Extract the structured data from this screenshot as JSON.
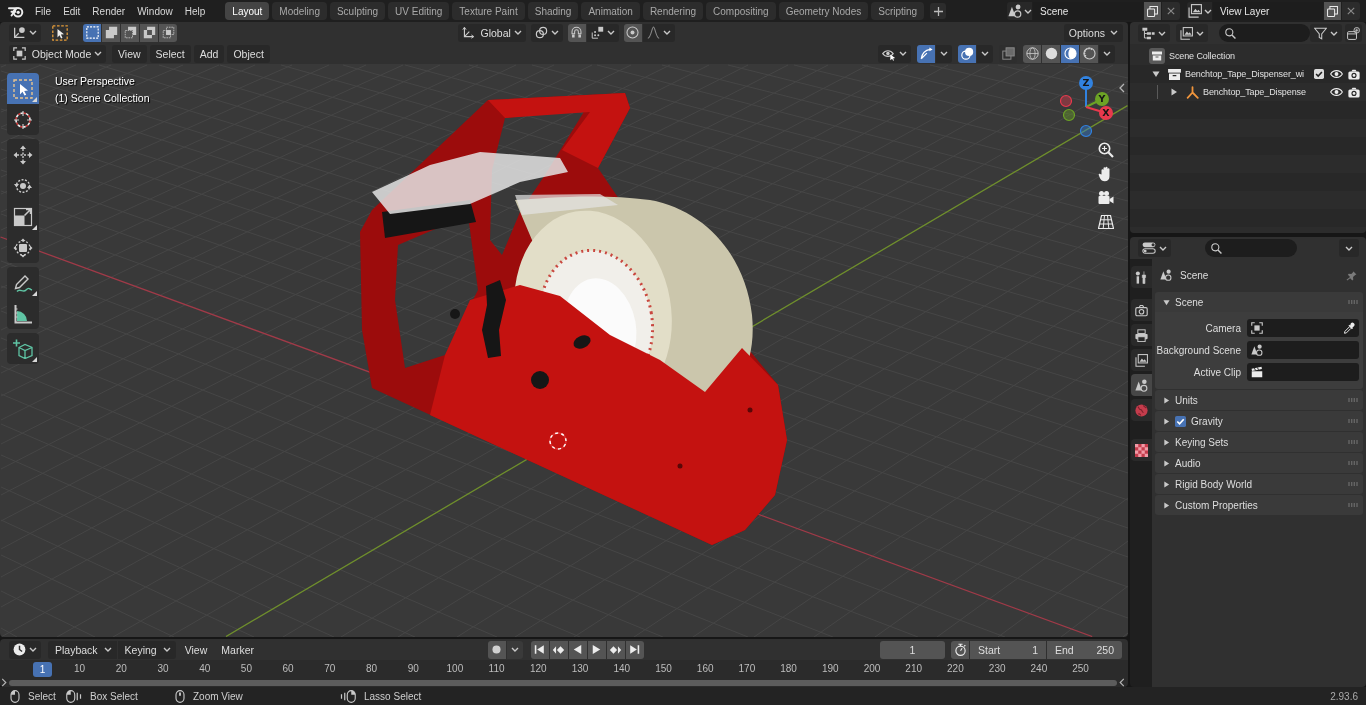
{
  "topbar": {
    "menus": [
      "File",
      "Edit",
      "Render",
      "Window",
      "Help"
    ],
    "workspaces": [
      {
        "label": "Layout",
        "selected": true
      },
      {
        "label": "Modeling",
        "selected": false
      },
      {
        "label": "Sculpting",
        "selected": false
      },
      {
        "label": "UV Editing",
        "selected": false
      },
      {
        "label": "Texture Paint",
        "selected": false
      },
      {
        "label": "Shading",
        "selected": false
      },
      {
        "label": "Animation",
        "selected": false
      },
      {
        "label": "Rendering",
        "selected": false
      },
      {
        "label": "Compositing",
        "selected": false
      },
      {
        "label": "Geometry Nodes",
        "selected": false
      },
      {
        "label": "Scripting",
        "selected": false
      }
    ],
    "scene": "Scene",
    "view_layer": "View Layer"
  },
  "viewport": {
    "tool_header": {
      "select_modes": [
        {
          "kind": "set",
          "selected": true
        },
        {
          "kind": "extend",
          "selected": false
        },
        {
          "kind": "subtract",
          "selected": false
        },
        {
          "kind": "difference",
          "selected": false
        },
        {
          "kind": "intersect",
          "selected": false
        }
      ],
      "orientation": "Global",
      "snap": {
        "on": false
      },
      "proportional": {
        "on": false
      },
      "options": "Options"
    },
    "header": {
      "mode": "Object Mode",
      "menus": [
        "View",
        "Select",
        "Add",
        "Object"
      ],
      "gizmos": {
        "on": true
      },
      "overlays": {
        "on": true
      },
      "xray": {
        "on": false
      },
      "shading": [
        {
          "kind": "wireframe",
          "selected": false
        },
        {
          "kind": "solid",
          "selected": false
        },
        {
          "kind": "material",
          "selected": true
        },
        {
          "kind": "rendered",
          "selected": false
        }
      ]
    },
    "view_name": "User Perspective",
    "collection_label": "(1) Scene Collection",
    "tool_groups": [
      [
        {
          "kind": "select_box",
          "selected": true
        },
        {
          "kind": "cursor",
          "selected": false
        }
      ],
      [
        {
          "kind": "move",
          "selected": false
        },
        {
          "kind": "rotate",
          "selected": false
        },
        {
          "kind": "scale",
          "selected": false
        },
        {
          "kind": "transform",
          "selected": false
        }
      ],
      [
        {
          "kind": "annotate",
          "selected": false
        },
        {
          "kind": "measure",
          "selected": false
        }
      ],
      [
        {
          "kind": "add_cube",
          "selected": false
        }
      ]
    ],
    "navigation_gizmo": {
      "axes": [
        {
          "kind": "z",
          "label": "Z",
          "color": "#3182e0"
        },
        {
          "kind": "y",
          "label": "Y",
          "color": "#6ca325"
        },
        {
          "kind": "x",
          "label": "X",
          "color": "#e8394d"
        }
      ]
    }
  },
  "timeline": {
    "dropdowns": [
      "Playback",
      "Keying"
    ],
    "menus": [
      "View",
      "Marker"
    ],
    "auto_keying": {
      "on": false
    },
    "current_frame": "1",
    "start": {
      "label": "Start",
      "value": "1"
    },
    "end": {
      "label": "End",
      "value": "250"
    },
    "playhead": "1",
    "frame_labels": [
      "10",
      "20",
      "30",
      "40",
      "50",
      "60",
      "70",
      "80",
      "90",
      "100",
      "110",
      "120",
      "130",
      "140",
      "150",
      "160",
      "170",
      "180",
      "190",
      "200",
      "210",
      "220",
      "230",
      "240",
      "250"
    ]
  },
  "outliner": {
    "tree": [
      {
        "label": "Scene Collection",
        "kind": "scene_collection",
        "children": [
          {
            "label": "Benchtop_Tape_Dispenser_wi",
            "kind": "collection",
            "expanded": true,
            "checked": true,
            "visible": true,
            "renderable": true,
            "children": [
              {
                "label": "Benchtop_Tape_Dispense",
                "kind": "object",
                "expanded": false,
                "visible": true,
                "renderable": true
              }
            ]
          }
        ]
      }
    ]
  },
  "properties": {
    "tabs": [
      {
        "kind": "tool",
        "selected": false
      },
      {
        "kind": "render",
        "selected": false
      },
      {
        "kind": "output",
        "selected": false
      },
      {
        "kind": "view_layer",
        "selected": false
      },
      {
        "kind": "scene",
        "selected": true
      },
      {
        "kind": "world",
        "selected": false
      },
      {
        "kind": "texture",
        "selected": false
      }
    ],
    "context": "Scene",
    "panels": [
      {
        "title": "Scene",
        "kind": "plain",
        "expanded": true,
        "fields": [
          {
            "label": "Camera",
            "kind": "camera"
          },
          {
            "label": "Background Scene",
            "kind": "scene"
          },
          {
            "label": "Active Clip",
            "kind": "clip"
          }
        ]
      },
      {
        "title": "Units",
        "kind": "plain",
        "expanded": false
      },
      {
        "title": "Gravity",
        "kind": "toggle",
        "expanded": false,
        "checked": true
      },
      {
        "title": "Keying Sets",
        "kind": "plain",
        "expanded": false
      },
      {
        "title": "Audio",
        "kind": "plain",
        "expanded": false
      },
      {
        "title": "Rigid Body World",
        "kind": "plain",
        "expanded": false
      },
      {
        "title": "Custom Properties",
        "kind": "plain",
        "expanded": false
      }
    ]
  },
  "status_bar": {
    "hints": [
      {
        "kind": "click",
        "label": "Select"
      },
      {
        "kind": "drag",
        "label": "Box Select"
      },
      {
        "kind": "middle",
        "label": "Zoom View"
      },
      {
        "kind": "drag_right",
        "label": "Lasso Select"
      }
    ],
    "version": "2.93.6"
  }
}
